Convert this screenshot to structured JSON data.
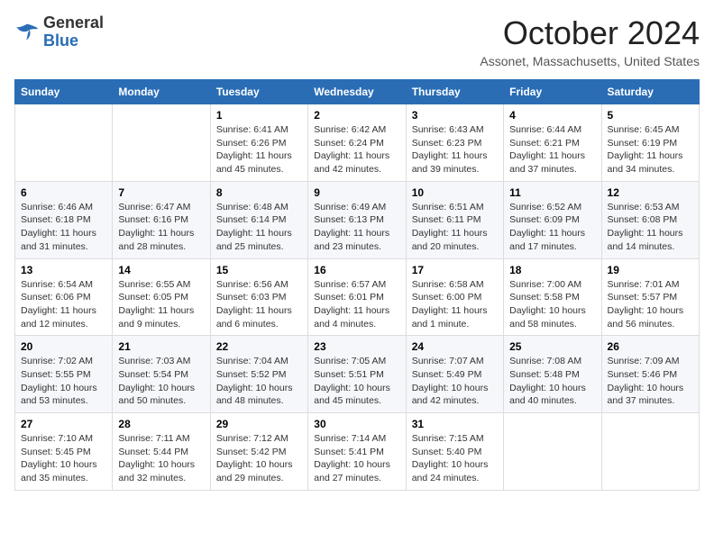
{
  "logo": {
    "general": "General",
    "blue": "Blue"
  },
  "title": "October 2024",
  "location": "Assonet, Massachusetts, United States",
  "days_of_week": [
    "Sunday",
    "Monday",
    "Tuesday",
    "Wednesday",
    "Thursday",
    "Friday",
    "Saturday"
  ],
  "weeks": [
    [
      {
        "day": "",
        "sunrise": "",
        "sunset": "",
        "daylight": ""
      },
      {
        "day": "",
        "sunrise": "",
        "sunset": "",
        "daylight": ""
      },
      {
        "day": "1",
        "sunrise": "Sunrise: 6:41 AM",
        "sunset": "Sunset: 6:26 PM",
        "daylight": "Daylight: 11 hours and 45 minutes."
      },
      {
        "day": "2",
        "sunrise": "Sunrise: 6:42 AM",
        "sunset": "Sunset: 6:24 PM",
        "daylight": "Daylight: 11 hours and 42 minutes."
      },
      {
        "day": "3",
        "sunrise": "Sunrise: 6:43 AM",
        "sunset": "Sunset: 6:23 PM",
        "daylight": "Daylight: 11 hours and 39 minutes."
      },
      {
        "day": "4",
        "sunrise": "Sunrise: 6:44 AM",
        "sunset": "Sunset: 6:21 PM",
        "daylight": "Daylight: 11 hours and 37 minutes."
      },
      {
        "day": "5",
        "sunrise": "Sunrise: 6:45 AM",
        "sunset": "Sunset: 6:19 PM",
        "daylight": "Daylight: 11 hours and 34 minutes."
      }
    ],
    [
      {
        "day": "6",
        "sunrise": "Sunrise: 6:46 AM",
        "sunset": "Sunset: 6:18 PM",
        "daylight": "Daylight: 11 hours and 31 minutes."
      },
      {
        "day": "7",
        "sunrise": "Sunrise: 6:47 AM",
        "sunset": "Sunset: 6:16 PM",
        "daylight": "Daylight: 11 hours and 28 minutes."
      },
      {
        "day": "8",
        "sunrise": "Sunrise: 6:48 AM",
        "sunset": "Sunset: 6:14 PM",
        "daylight": "Daylight: 11 hours and 25 minutes."
      },
      {
        "day": "9",
        "sunrise": "Sunrise: 6:49 AM",
        "sunset": "Sunset: 6:13 PM",
        "daylight": "Daylight: 11 hours and 23 minutes."
      },
      {
        "day": "10",
        "sunrise": "Sunrise: 6:51 AM",
        "sunset": "Sunset: 6:11 PM",
        "daylight": "Daylight: 11 hours and 20 minutes."
      },
      {
        "day": "11",
        "sunrise": "Sunrise: 6:52 AM",
        "sunset": "Sunset: 6:09 PM",
        "daylight": "Daylight: 11 hours and 17 minutes."
      },
      {
        "day": "12",
        "sunrise": "Sunrise: 6:53 AM",
        "sunset": "Sunset: 6:08 PM",
        "daylight": "Daylight: 11 hours and 14 minutes."
      }
    ],
    [
      {
        "day": "13",
        "sunrise": "Sunrise: 6:54 AM",
        "sunset": "Sunset: 6:06 PM",
        "daylight": "Daylight: 11 hours and 12 minutes."
      },
      {
        "day": "14",
        "sunrise": "Sunrise: 6:55 AM",
        "sunset": "Sunset: 6:05 PM",
        "daylight": "Daylight: 11 hours and 9 minutes."
      },
      {
        "day": "15",
        "sunrise": "Sunrise: 6:56 AM",
        "sunset": "Sunset: 6:03 PM",
        "daylight": "Daylight: 11 hours and 6 minutes."
      },
      {
        "day": "16",
        "sunrise": "Sunrise: 6:57 AM",
        "sunset": "Sunset: 6:01 PM",
        "daylight": "Daylight: 11 hours and 4 minutes."
      },
      {
        "day": "17",
        "sunrise": "Sunrise: 6:58 AM",
        "sunset": "Sunset: 6:00 PM",
        "daylight": "Daylight: 11 hours and 1 minute."
      },
      {
        "day": "18",
        "sunrise": "Sunrise: 7:00 AM",
        "sunset": "Sunset: 5:58 PM",
        "daylight": "Daylight: 10 hours and 58 minutes."
      },
      {
        "day": "19",
        "sunrise": "Sunrise: 7:01 AM",
        "sunset": "Sunset: 5:57 PM",
        "daylight": "Daylight: 10 hours and 56 minutes."
      }
    ],
    [
      {
        "day": "20",
        "sunrise": "Sunrise: 7:02 AM",
        "sunset": "Sunset: 5:55 PM",
        "daylight": "Daylight: 10 hours and 53 minutes."
      },
      {
        "day": "21",
        "sunrise": "Sunrise: 7:03 AM",
        "sunset": "Sunset: 5:54 PM",
        "daylight": "Daylight: 10 hours and 50 minutes."
      },
      {
        "day": "22",
        "sunrise": "Sunrise: 7:04 AM",
        "sunset": "Sunset: 5:52 PM",
        "daylight": "Daylight: 10 hours and 48 minutes."
      },
      {
        "day": "23",
        "sunrise": "Sunrise: 7:05 AM",
        "sunset": "Sunset: 5:51 PM",
        "daylight": "Daylight: 10 hours and 45 minutes."
      },
      {
        "day": "24",
        "sunrise": "Sunrise: 7:07 AM",
        "sunset": "Sunset: 5:49 PM",
        "daylight": "Daylight: 10 hours and 42 minutes."
      },
      {
        "day": "25",
        "sunrise": "Sunrise: 7:08 AM",
        "sunset": "Sunset: 5:48 PM",
        "daylight": "Daylight: 10 hours and 40 minutes."
      },
      {
        "day": "26",
        "sunrise": "Sunrise: 7:09 AM",
        "sunset": "Sunset: 5:46 PM",
        "daylight": "Daylight: 10 hours and 37 minutes."
      }
    ],
    [
      {
        "day": "27",
        "sunrise": "Sunrise: 7:10 AM",
        "sunset": "Sunset: 5:45 PM",
        "daylight": "Daylight: 10 hours and 35 minutes."
      },
      {
        "day": "28",
        "sunrise": "Sunrise: 7:11 AM",
        "sunset": "Sunset: 5:44 PM",
        "daylight": "Daylight: 10 hours and 32 minutes."
      },
      {
        "day": "29",
        "sunrise": "Sunrise: 7:12 AM",
        "sunset": "Sunset: 5:42 PM",
        "daylight": "Daylight: 10 hours and 29 minutes."
      },
      {
        "day": "30",
        "sunrise": "Sunrise: 7:14 AM",
        "sunset": "Sunset: 5:41 PM",
        "daylight": "Daylight: 10 hours and 27 minutes."
      },
      {
        "day": "31",
        "sunrise": "Sunrise: 7:15 AM",
        "sunset": "Sunset: 5:40 PM",
        "daylight": "Daylight: 10 hours and 24 minutes."
      },
      {
        "day": "",
        "sunrise": "",
        "sunset": "",
        "daylight": ""
      },
      {
        "day": "",
        "sunrise": "",
        "sunset": "",
        "daylight": ""
      }
    ]
  ]
}
